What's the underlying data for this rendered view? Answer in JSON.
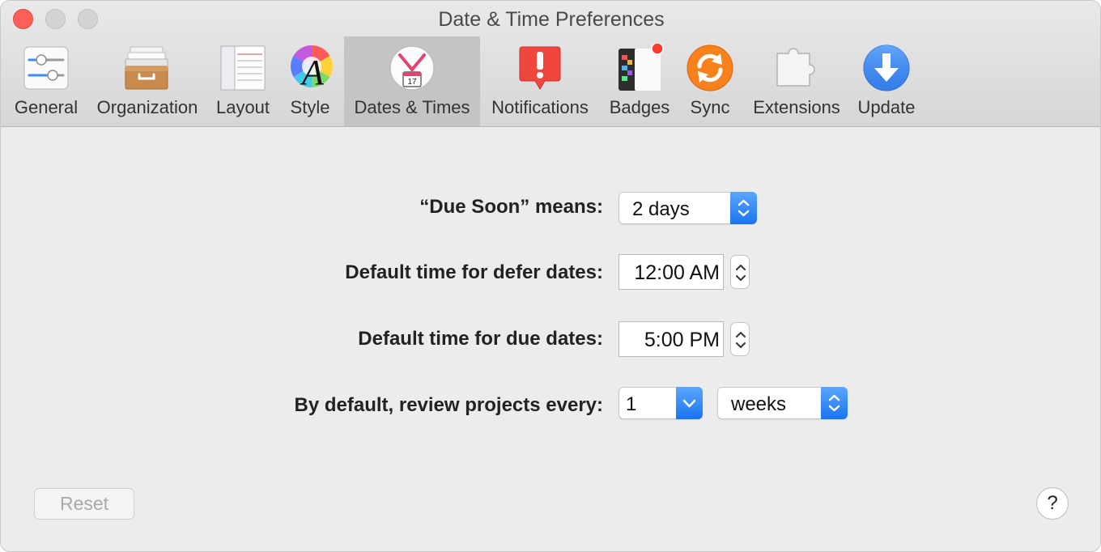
{
  "window": {
    "title": "Date & Time Preferences"
  },
  "toolbar": {
    "selected_tab": "Dates & Times",
    "tabs": [
      {
        "label": "General",
        "icon": "sliders-icon"
      },
      {
        "label": "Organization",
        "icon": "archive-drawer-icon"
      },
      {
        "label": "Layout",
        "icon": "layout-columns-icon"
      },
      {
        "label": "Style",
        "icon": "color-wheel-font-icon"
      },
      {
        "label": "Dates & Times",
        "icon": "clock-calendar-icon",
        "calendar_day": "17"
      },
      {
        "label": "Notifications",
        "icon": "exclamation-bubble-icon"
      },
      {
        "label": "Badges",
        "icon": "badge-notebook-icon"
      },
      {
        "label": "Sync",
        "icon": "sync-arrows-icon"
      },
      {
        "label": "Extensions",
        "icon": "puzzle-piece-icon"
      },
      {
        "label": "Update",
        "icon": "download-arrow-icon"
      }
    ]
  },
  "form": {
    "due_soon": {
      "label": "“Due Soon” means:",
      "value": "2 days"
    },
    "defer_time": {
      "label": "Default time for defer dates:",
      "value": "12:00 AM"
    },
    "due_time": {
      "label": "Default time for due dates:",
      "value": "5:00 PM"
    },
    "review": {
      "label": "By default, review projects every:",
      "count": "1",
      "unit": "weeks"
    }
  },
  "footer": {
    "reset_label": "Reset",
    "help_label": "?"
  },
  "colors": {
    "accent": "#1a74f0",
    "close": "#fc5f57",
    "selected_tab": "#c4c4c4",
    "window_bg": "#ececec"
  }
}
